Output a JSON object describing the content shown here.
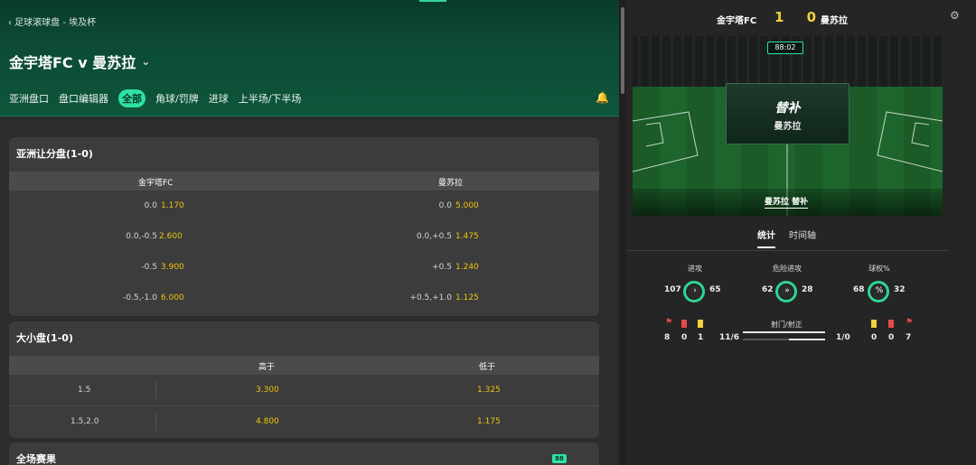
{
  "breadcrumb": "‹ 足球滚球盘 - 埃及杯",
  "match_title": "金宇塔FC v 曼苏拉",
  "tabs": [
    "亚洲盘口",
    "盘口编辑器",
    "全部",
    "角球/罚牌",
    "进球",
    "上半场/下半场"
  ],
  "active_tab_index": 2,
  "asian_handicap": {
    "title": "亚洲让分盘(1-0)",
    "home": "金宇塔FC",
    "away": "曼苏拉",
    "rows": [
      {
        "home_line": "0.0",
        "home_odds": "1.170",
        "away_line": "0.0",
        "away_odds": "5.000"
      },
      {
        "home_line": "0.0,-0.5",
        "home_odds": "2.600",
        "away_line": "0.0,+0.5",
        "away_odds": "1.475"
      },
      {
        "home_line": "-0.5",
        "home_odds": "3.900",
        "away_line": "+0.5",
        "away_odds": "1.240"
      },
      {
        "home_line": "-0.5,-1.0",
        "home_odds": "6.000",
        "away_line": "+0.5,+1.0",
        "away_odds": "1.125"
      }
    ]
  },
  "over_under": {
    "title": "大小盘(1-0)",
    "over_label": "高于",
    "under_label": "低于",
    "rows": [
      {
        "line": "1.5",
        "over": "3.300",
        "under": "1.325"
      },
      {
        "line": "1.5,2.0",
        "over": "4.800",
        "under": "1.175"
      }
    ]
  },
  "next_section": {
    "title": "全场赛果",
    "badge": "88"
  },
  "live": {
    "home": "金宇塔FC",
    "away": "曼苏拉",
    "score": "1 0",
    "clock": "88:02",
    "event_title": "替补",
    "event_team": "曼苏拉",
    "caption": "曼苏拉 替补",
    "tabs": [
      "统计",
      "时间轴"
    ]
  },
  "stats": [
    {
      "label": "进攻",
      "home": "107",
      "away": "65",
      "icon": "›"
    },
    {
      "label": "危险进攻",
      "home": "62",
      "away": "28",
      "icon": "»"
    },
    {
      "label": "球权%",
      "home": "68",
      "away": "32",
      "icon": "%"
    }
  ],
  "cards": {
    "home": {
      "corners": "8",
      "red": "0",
      "yellow": "1"
    },
    "away": {
      "yellow": "0",
      "red": "0",
      "corners": "7"
    },
    "shots_label": "射门/射正",
    "home_shots": "11/6",
    "away_shots": "1/0"
  },
  "colors": {
    "accent": "#2fe1a4",
    "odds": "#f1c40f",
    "hero_dark": "#0a3b2b",
    "yellow_card": "#f2d23d",
    "red_card": "#e34b4b"
  }
}
